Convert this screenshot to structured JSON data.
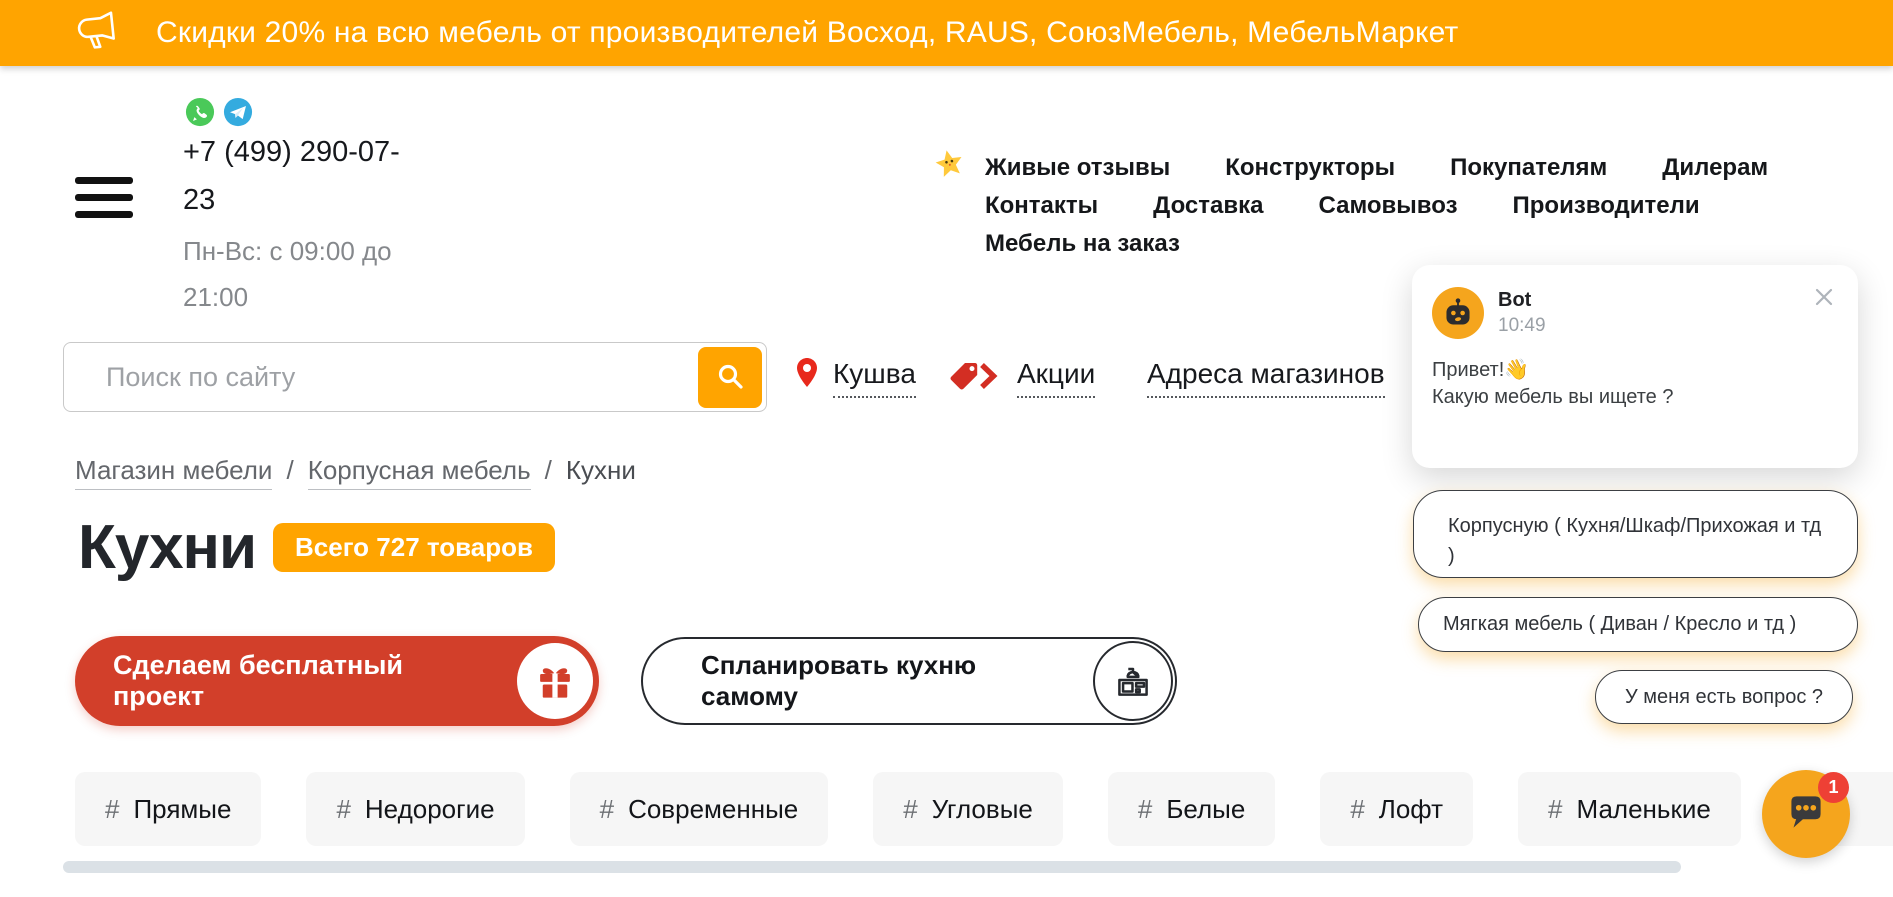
{
  "banner": {
    "text": "Скидки 20% на всю мебель от производителей Восход, RAUS, СоюзМебель, МебельМаркет"
  },
  "header": {
    "phone": "+7 (499) 290-07-23",
    "hours": "Пн-Вс: с 09:00 до 21:00",
    "nav": [
      {
        "label": "Живые отзывы"
      },
      {
        "label": "Конструкторы"
      },
      {
        "label": "Покупателям"
      },
      {
        "label": "Дилерам"
      },
      {
        "label": "Контакты"
      },
      {
        "label": "Доставка"
      },
      {
        "label": "Самовывоз"
      },
      {
        "label": "Производители"
      },
      {
        "label": "Мебель на заказ"
      }
    ],
    "links": {
      "city": "Кушва",
      "promos": "Акции",
      "addresses": "Адреса магазинов"
    }
  },
  "search": {
    "placeholder": "Поиск по сайту"
  },
  "breadcrumb": {
    "items": [
      "Магазин мебели",
      "Корпусная мебель",
      "Кухни"
    ],
    "separator": "/"
  },
  "page": {
    "title": "Кухни",
    "badge": "Всего 727 товаров",
    "cta_primary": "Сделаем бесплатный проект",
    "cta_secondary": "Спланировать кухню самому"
  },
  "tags": {
    "prefix": "#",
    "items": [
      "Прямые",
      "Недорогие",
      "Современные",
      "Угловые",
      "Белые",
      "Лофт",
      "Маленькие"
    ]
  },
  "chat": {
    "name": "Bot",
    "time": "10:49",
    "greeting": "Привет!👋",
    "question": "Какую мебель вы ищете ?",
    "options": [
      "Корпусную ( Кухня/Шкаф/Прихожая и тд )",
      "Мягкая мебель ( Диван / Кресло и тд )",
      "У меня есть вопрос ?"
    ],
    "unread": "1"
  },
  "icons": {
    "megaphone": "promo announcement",
    "whatsapp": "messenger",
    "telegram": "messenger",
    "star": "reviews mascot",
    "magnifier": "search",
    "map-pin": "city location",
    "price-tags": "promotions",
    "gift": "free project",
    "kitchen": "kitchen planner",
    "robot": "chat bot avatar",
    "chat-bubble": "chat launcher",
    "close": "dismiss chat"
  },
  "colors": {
    "accent_orange": "#FFA400",
    "fab_orange": "#F5A51D",
    "cta_red": "#D23F2A",
    "pin_red": "#E8291C",
    "tag_red": "#D32E23",
    "badge_red": "#EE4035",
    "whatsapp_green": "#4AC959",
    "telegram_blue": "#34ABDF",
    "chip_bg": "#F6F6F6"
  }
}
